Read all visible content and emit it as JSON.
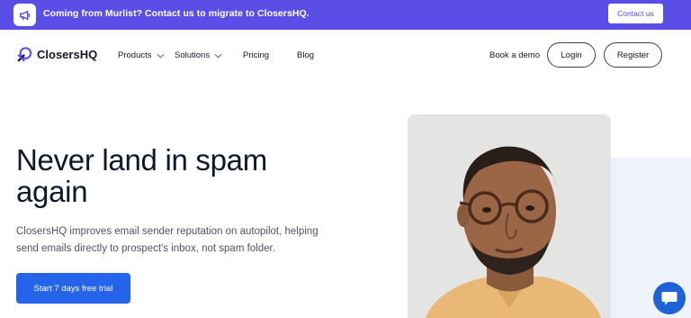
{
  "banner": {
    "icon": "megaphone-icon",
    "text": "Coming from Murlist? Contact us to migrate to ClosersHQ.",
    "button_label": "Contact us",
    "background_color": "#5b4ee6"
  },
  "nav": {
    "logo_text": "ClosersHQ",
    "items": [
      {
        "label": "Products",
        "has_dropdown": true
      },
      {
        "label": "Solutions",
        "has_dropdown": true
      },
      {
        "label": "Pricing",
        "has_dropdown": false
      },
      {
        "label": "Blog",
        "has_dropdown": false
      }
    ],
    "book_demo_label": "Book a demo",
    "login_label": "Login",
    "register_label": "Register"
  },
  "hero": {
    "title": "Never land in spam again",
    "subtitle": "ClosersHQ improves email sender reputation on autopilot, helping send emails directly to prospect's inbox, not spam folder.",
    "cta_label": "Start 7 days free trial",
    "cta_color": "#2563eb",
    "image": "man-with-glasses-portrait"
  },
  "chat": {
    "icon": "chat-bubble-icon",
    "color": "#1e62d6"
  }
}
